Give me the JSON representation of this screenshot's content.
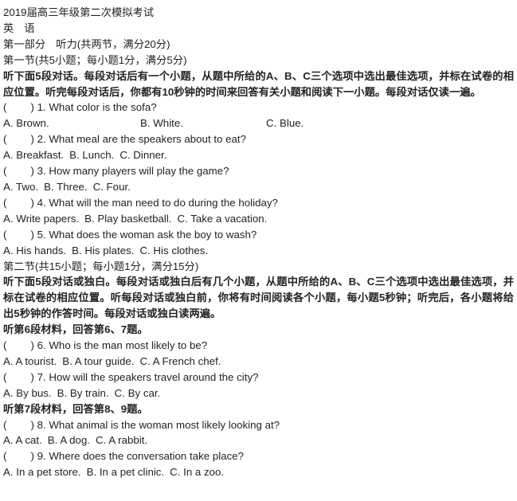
{
  "document": {
    "title_line_1": "2019届高三年级第二次模拟考试",
    "subject_char_1": "英",
    "subject_char_2": "语",
    "part_one_label": "第一部分",
    "part_one_title": "听力(共两节，满分20分)",
    "section_one_heading": "第一节(共5小题；每小题1分，满分5分)",
    "section_one_instructions": "听下面5段对话。每段对话后有一个小题，从题中所给的A、B、C三个选项中选出最佳选项，并标在试卷的相应位置。听完每段对话后，你都有10秒钟的时间来回答有关小题和阅读下一小题。每段对话仅读一遍。",
    "section_two_heading": "第二节(共15小题；每小题1分，满分15分)",
    "section_two_instructions": "听下面5段对话或独白。每段对话或独白后有几个小题，从题中所给的A、B、C三个选项中选出最佳选项，并标在试卷的相应位置。听每段对话或独白前，你将有时间阅读各个小题，每小题5秒钟；听完后，各小题将给出5秒钟的作答时间。每段对话或独白读两遍。",
    "cue_material_6": "听第6段材料，回答第6、7题。",
    "cue_material_7": "听第7段材料，回答第8、9题。",
    "paren_open": "(",
    "paren_close": ")",
    "questions": [
      {
        "number": "1.",
        "stem": "What color is the sofa?",
        "layout": "wide",
        "options": [
          "A. Brown.",
          "B. White.",
          "C. Blue."
        ]
      },
      {
        "number": "2.",
        "stem": "What meal are the speakers about to eat?",
        "layout": "inline",
        "options": [
          "A. Breakfast.",
          "B. Lunch.",
          "C. Dinner."
        ]
      },
      {
        "number": "3.",
        "stem": "How many players will play the game?",
        "layout": "inline",
        "options": [
          "A. Two.",
          "B. Three.",
          "C. Four."
        ]
      },
      {
        "number": "4.",
        "stem": "What will the man need to do during the holiday?",
        "layout": "inline",
        "options": [
          "A. Write papers.",
          "B. Play basketball.",
          "C. Take a vacation."
        ]
      },
      {
        "number": "5.",
        "stem": "What does the woman ask the boy to wash?",
        "layout": "inline",
        "options": [
          "A. His hands.",
          "B. His plates.",
          "C. His clothes."
        ]
      },
      {
        "number": "6.",
        "stem": "Who is the man most likely to be?",
        "layout": "inline",
        "options": [
          "A. A tourist.",
          "B. A tour guide.",
          "C. A French chef."
        ]
      },
      {
        "number": "7.",
        "stem": "How will the speakers travel around the city?",
        "layout": "inline",
        "options": [
          "A. By bus.",
          "B. By train.",
          "C. By car."
        ]
      },
      {
        "number": "8.",
        "stem": "What animal is the woman most likely looking at?",
        "layout": "inline",
        "options": [
          "A. A cat.",
          "B. A dog.",
          "C. A rabbit."
        ]
      },
      {
        "number": "9.",
        "stem": "Where does the conversation take place?",
        "layout": "inline",
        "options": [
          "A. In a pet store.",
          "B. In a pet clinic.",
          "C. In a zoo."
        ]
      }
    ]
  }
}
